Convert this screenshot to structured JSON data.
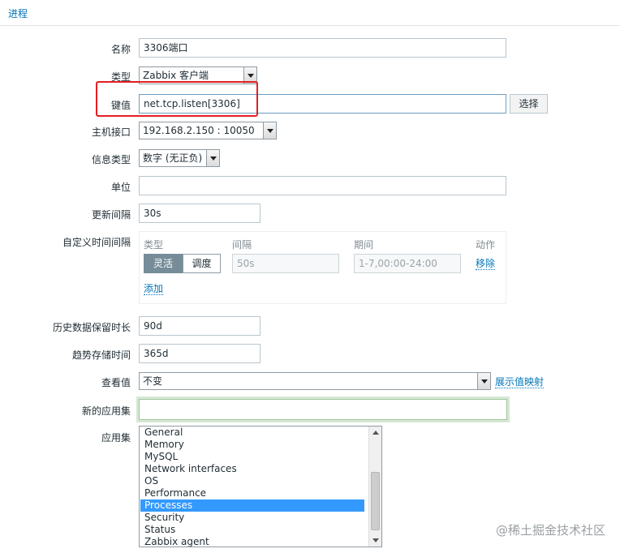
{
  "tab": {
    "label": "进程"
  },
  "form": {
    "name": {
      "label": "名称",
      "value": "3306端口"
    },
    "type": {
      "label": "类型",
      "value": "Zabbix 客户端"
    },
    "key": {
      "label": "键值",
      "value": "net.tcp.listen[3306]",
      "select_button": "选择"
    },
    "host_interface": {
      "label": "主机接口",
      "value": "192.168.2.150 : 10050"
    },
    "info_type": {
      "label": "信息类型",
      "value": "数字 (无正负)"
    },
    "units": {
      "label": "单位",
      "value": ""
    },
    "update_interval": {
      "label": "更新间隔",
      "value": "30s"
    },
    "custom_intervals": {
      "label": "自定义时间间隔",
      "col_type": "类型",
      "col_interval": "间隔",
      "col_period": "期间",
      "col_action": "动作",
      "mode_flexible": "灵活",
      "mode_scheduling": "调度",
      "interval_placeholder": "50s",
      "period_placeholder": "1-7,00:00-24:00",
      "remove_link": "移除",
      "add_link": "添加"
    },
    "history": {
      "label": "历史数据保留时长",
      "value": "90d"
    },
    "trends": {
      "label": "趋势存储时间",
      "value": "365d"
    },
    "show_value": {
      "label": "查看值",
      "value": "不变",
      "mapping_link": "展示值映射"
    },
    "new_application": {
      "label": "新的应用集",
      "value": ""
    },
    "applications": {
      "label": "应用集",
      "options": [
        "General",
        "Memory",
        "MySQL",
        "Network interfaces",
        "OS",
        "Performance",
        "Processes",
        "Security",
        "Status",
        "Zabbix agent"
      ],
      "selected": "Processes"
    }
  },
  "watermark": "@稀土掘金技术社区",
  "colors": {
    "link": "#0275b8",
    "highlight_box": "#e31e24",
    "selected_option": "#3399ff"
  }
}
